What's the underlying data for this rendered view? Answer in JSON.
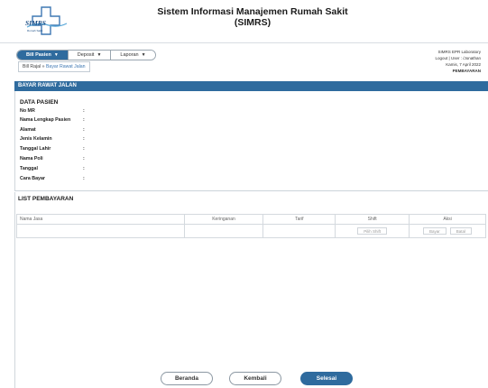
{
  "header": {
    "logo_text": "SIMRS",
    "logo_subtext": "Rumah Sakit",
    "title_line1": "Sistem Informasi Manajemen Rumah Sakit",
    "title_line2": "(SIMRS)"
  },
  "nav": {
    "items": [
      {
        "label": "Bill Pasien",
        "active": true
      },
      {
        "label": "Deposit",
        "active": false
      },
      {
        "label": "Laporan",
        "active": false
      }
    ],
    "caret": "▼"
  },
  "breadcrumb": {
    "root": "Bill Rajal",
    "separator": " » ",
    "current": "Bayar Rawat Jalan"
  },
  "info": {
    "line1": "SIMRS EPR Laboratory",
    "line2": "Logout | User : /Jonathan",
    "line3": "Kamis, 7 April 2022",
    "line4": "PEMBAYARAN"
  },
  "section": {
    "title": "BAYAR RAWAT JALAN"
  },
  "pasien": {
    "title": "DATA PASIEN",
    "fields": [
      {
        "label": "No MR",
        "colon": ":"
      },
      {
        "label": "Nama Lengkap Pasien",
        "colon": ":"
      },
      {
        "label": "Alamat",
        "colon": ":"
      },
      {
        "label": "Jenis Kelamin",
        "colon": ":"
      },
      {
        "label": "Tanggal Lahir",
        "colon": ":"
      },
      {
        "label": "Nama Poli",
        "colon": ":"
      },
      {
        "label": "Tanggal",
        "colon": ":"
      },
      {
        "label": "Cara Bayar",
        "colon": ":"
      }
    ]
  },
  "list": {
    "title": "LIST PEMBAYARAN",
    "columns": [
      "Nama Jasa",
      "Keringanan",
      "Tarif",
      "Shift",
      "Aksi"
    ],
    "shift_button": "Pilih Shift",
    "action_buttons": [
      "Bayar",
      "Batal"
    ]
  },
  "footer": {
    "buttons": [
      "Beranda",
      "Kembali",
      "Selesai"
    ]
  },
  "colors": {
    "primary": "#2f6b9e"
  }
}
